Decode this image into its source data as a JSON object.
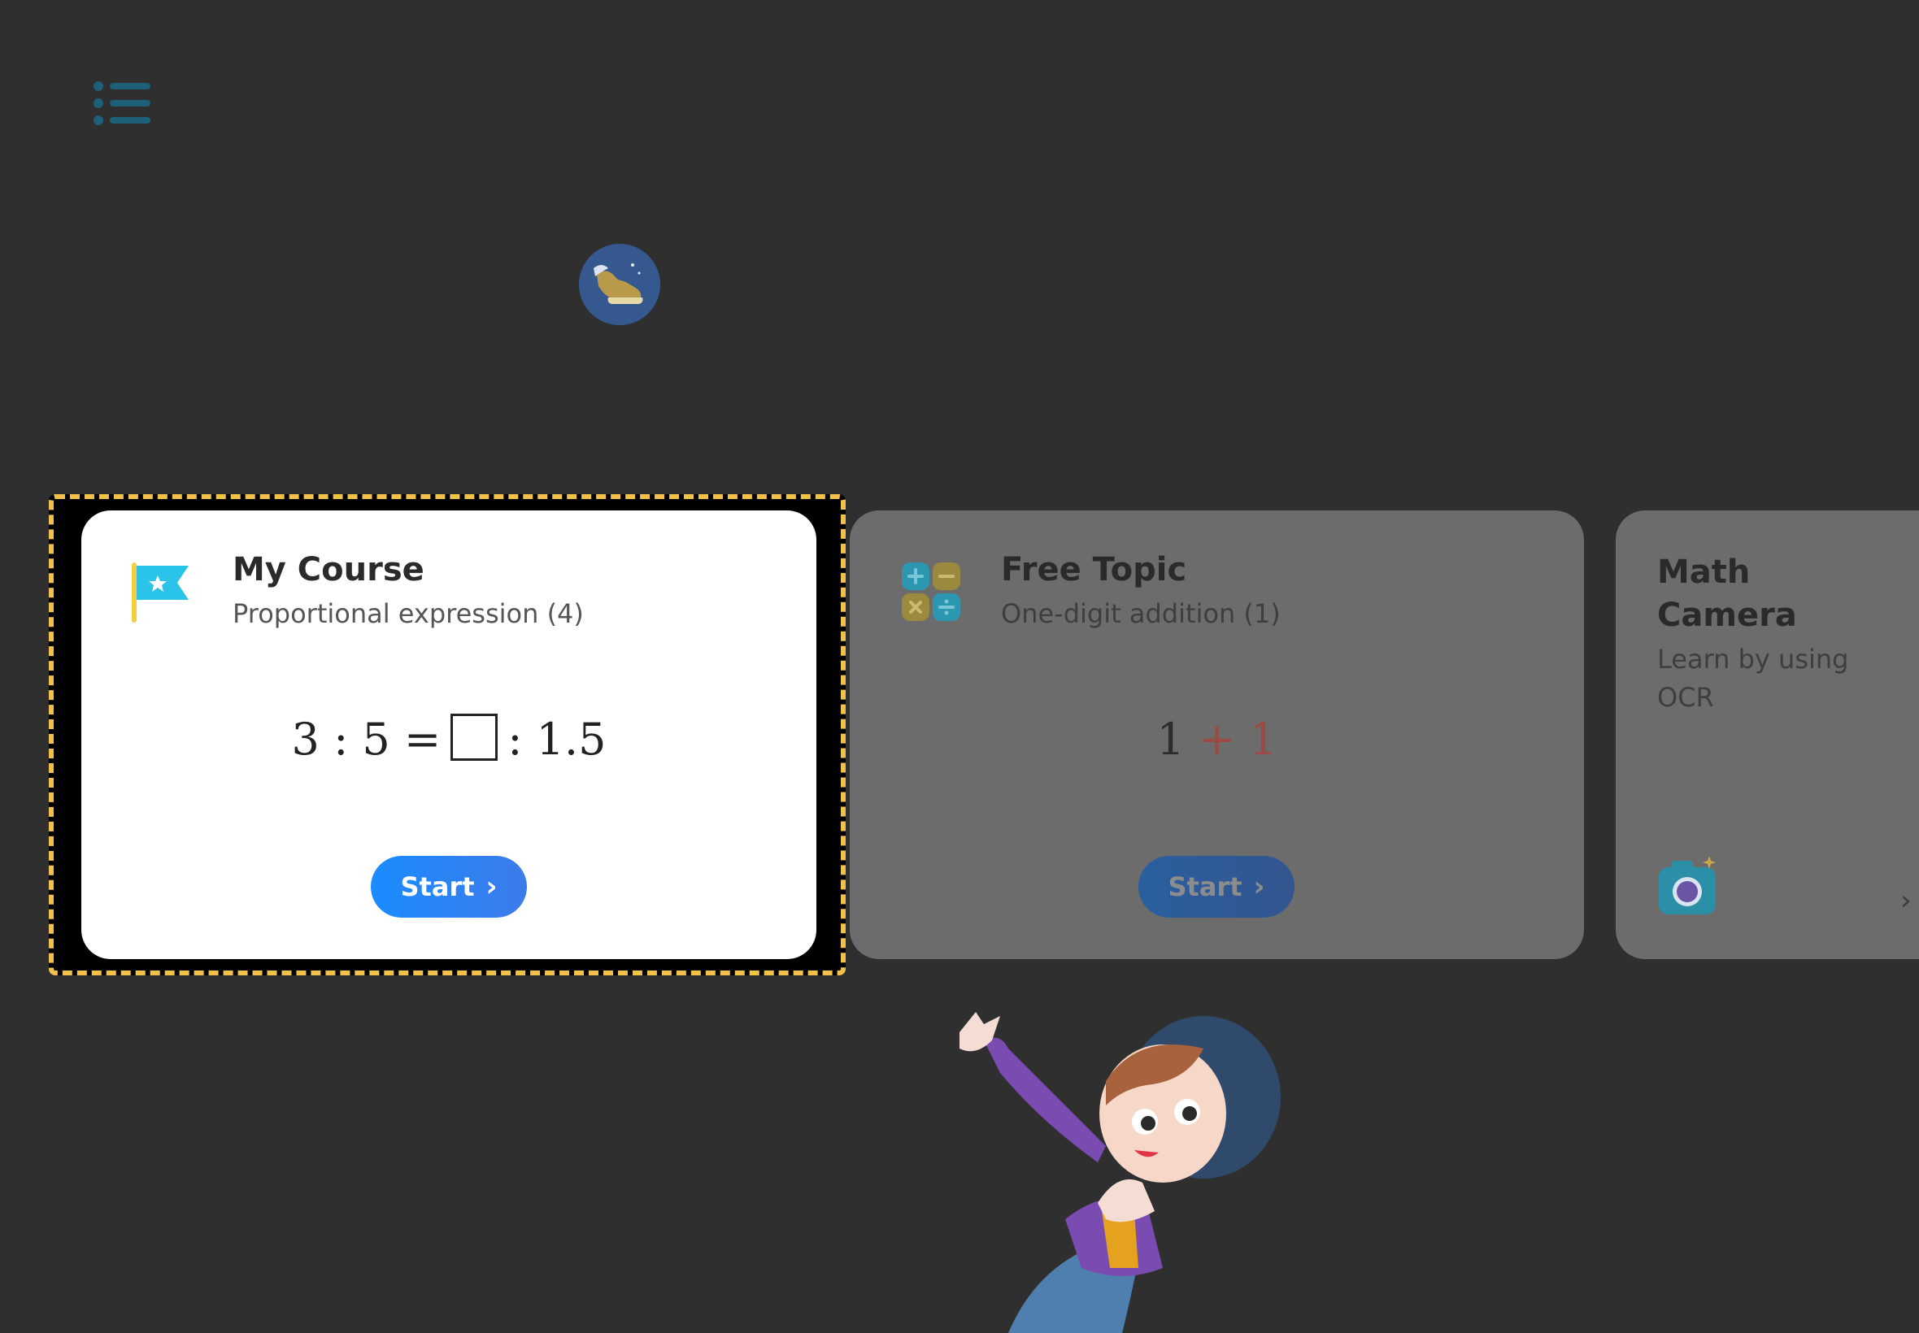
{
  "menu": {
    "icon": "menu-list-icon"
  },
  "badge": {
    "icon": "flying-shoe-icon"
  },
  "cards": {
    "my_course": {
      "icon": "flag-star-icon",
      "title": "My Course",
      "subtitle": "Proportional expression (4)",
      "equation": {
        "left": "3 : 5 =",
        "right": ": 1.5"
      },
      "start_label": "Start"
    },
    "free_topic": {
      "icon": "math-operators-icon",
      "title": "Free Topic",
      "subtitle": "One-digit addition (1)",
      "equation": {
        "a": "1",
        "op": "+",
        "b": "1"
      },
      "start_label": "Start"
    },
    "math_camera": {
      "icon": "camera-icon",
      "title": "Math Camera",
      "subtitle": "Learn by using OCR"
    }
  },
  "colors": {
    "background": "#2f2f2f",
    "focus_border": "#f2c14a",
    "start_button": "#1a8cff",
    "card_active": "#ffffff",
    "card_dimmed": "#6c6c6c"
  }
}
